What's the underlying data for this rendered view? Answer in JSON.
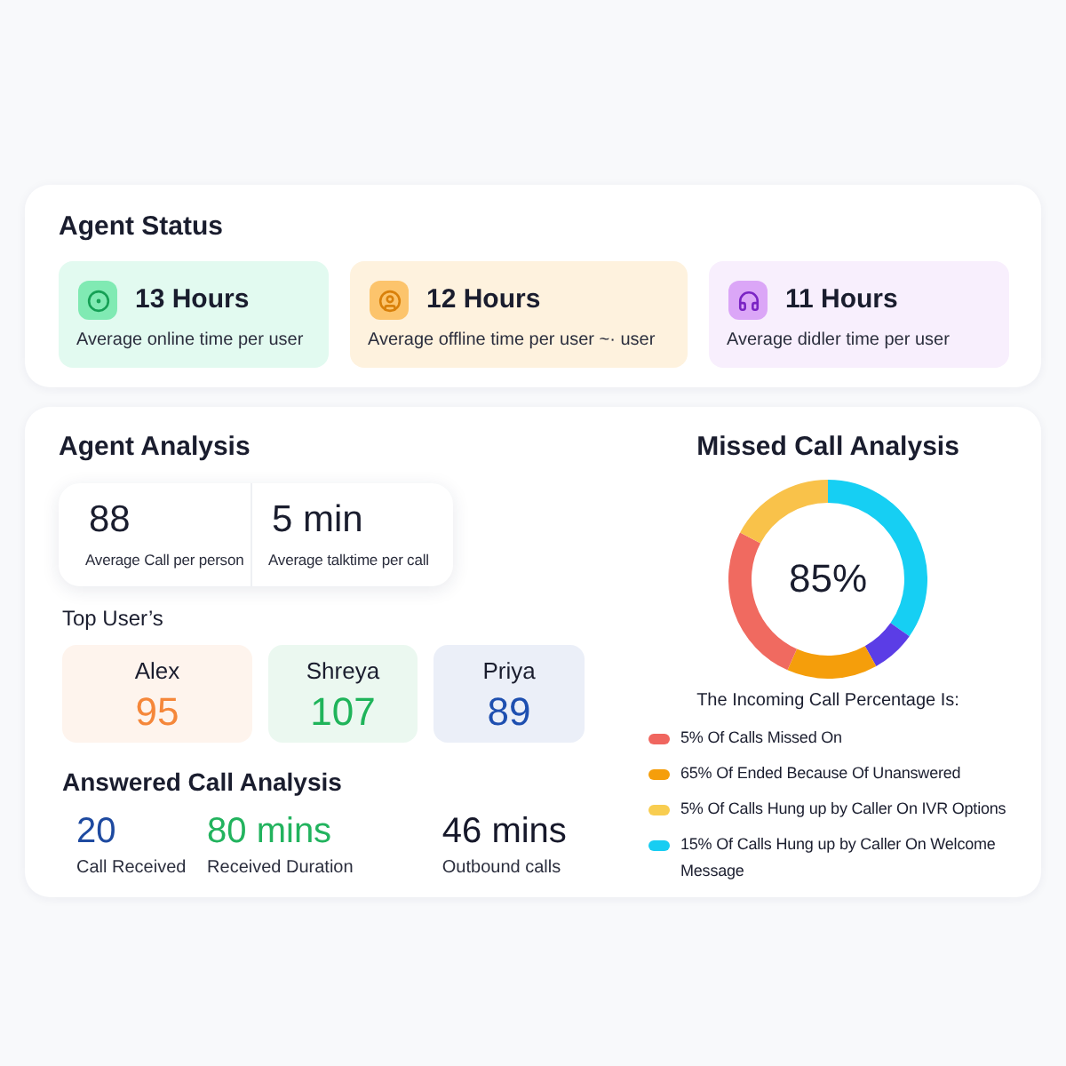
{
  "agent_status": {
    "title": "Agent Status",
    "tiles": [
      {
        "kind": "online",
        "value": "13 Hours",
        "caption": "Average online time per user"
      },
      {
        "kind": "offline",
        "value": "12 Hours",
        "caption": "Average offline time per user ~· user"
      },
      {
        "kind": "idle",
        "value": "11 Hours",
        "caption": "Average didler time per user"
      }
    ]
  },
  "agent_analysis": {
    "title": "Agent Analysis",
    "stats": [
      {
        "value": "88",
        "caption": "Average Call per person"
      },
      {
        "value": "5 min",
        "caption": "Average talktime per call"
      }
    ]
  },
  "top_users": {
    "title": "Top User’s",
    "users": [
      {
        "name": "Alex",
        "score": "95",
        "color": "#f5873a"
      },
      {
        "name": "Shreya",
        "score": "107",
        "color": "#1fb45a"
      },
      {
        "name": "Priya",
        "score": "89",
        "color": "#1e4fb0"
      }
    ]
  },
  "answered_calls": {
    "title": "Answered Call Analysis",
    "stats": [
      {
        "value": "20",
        "caption": "Call Received",
        "color": "#1e4aa0"
      },
      {
        "value": "80 mins",
        "caption": "Received Duration",
        "color": "#22b35e"
      },
      {
        "value": "46 mins",
        "caption": "Outbound calls",
        "color": "#16182a"
      }
    ]
  },
  "missed_calls": {
    "title": "Missed Call Analysis",
    "center_label": "85%",
    "legend_title": "The Incoming Call Percentage Is:",
    "legend": [
      {
        "label": "5% Of Calls Missed On",
        "color": "#f0665f"
      },
      {
        "label": "65% Of Ended Because Of Unanswered",
        "color": "#f59e0b"
      },
      {
        "label": "5% Of Calls Hung up by Caller On IVR Options",
        "color": "#f8cd50"
      },
      {
        "label": "15% Of Calls Hung up by Caller On Welcome Message",
        "color": "#18cdf2"
      }
    ]
  }
}
